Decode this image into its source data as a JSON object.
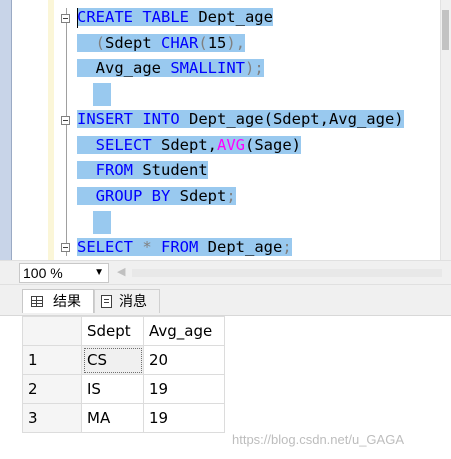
{
  "editor": {
    "lines": {
      "l1": {
        "kw1": "CREATE TABLE",
        "name": " Dept_age"
      },
      "l2": {
        "paren_open": "(",
        "col": "Sdept ",
        "type": "CHAR",
        "paren": "(",
        "num": "15",
        "rest": "),"
      },
      "l3": {
        "col": "Avg_age ",
        "type": "SMALLINT",
        "rest": ");"
      },
      "l5": {
        "kw": "INSERT INTO",
        "rest": " Dept_age(Sdept,Avg_age)"
      },
      "l6": {
        "kw": "SELECT",
        "mid": " Sdept,",
        "fn": "AVG",
        "rest": "(Sage)"
      },
      "l7": {
        "kw": "FROM",
        "rest": " Student"
      },
      "l8": {
        "kw": "GROUP BY",
        "rest": " Sdept",
        "semi": ";"
      },
      "l10": {
        "kw": "SELECT",
        "star": " * ",
        "kw2": "FROM",
        "rest": " Dept_age",
        "semi": ";"
      }
    }
  },
  "zoom": {
    "value": "100 %"
  },
  "tabs": {
    "results": "结果",
    "messages": "消息"
  },
  "grid": {
    "headers": [
      "Sdept",
      "Avg_age"
    ],
    "rows": [
      {
        "num": "1",
        "sdept": "CS",
        "avg_age": "20"
      },
      {
        "num": "2",
        "sdept": "IS",
        "avg_age": "19"
      },
      {
        "num": "3",
        "sdept": "MA",
        "avg_age": "19"
      }
    ]
  },
  "watermark": "https://blog.csdn.net/u_GAGA",
  "colors": {
    "keyword": "#0000ff",
    "function": "#ff00ff",
    "operator": "#808080",
    "selection": "#99c9ef"
  }
}
